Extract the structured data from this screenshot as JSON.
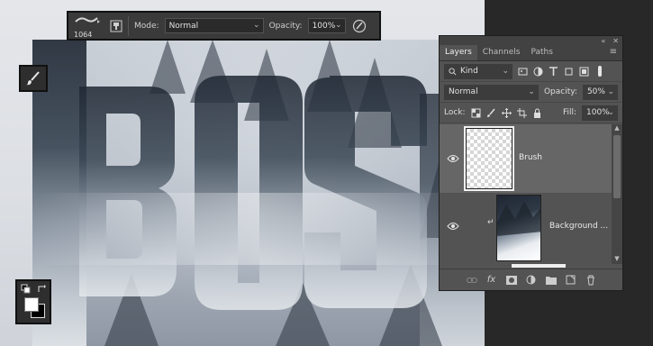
{
  "options_bar": {
    "brush_size": "1064",
    "mode_label": "Mode:",
    "mode_value": "Normal",
    "opacity_label": "Opacity:",
    "opacity_value": "100%"
  },
  "layers_panel": {
    "tabs": [
      "Layers",
      "Channels",
      "Paths"
    ],
    "active_tab": "Layers",
    "filter_kind": "Kind",
    "blend_mode": "Normal",
    "opacity_label": "Opacity:",
    "opacity_value": "50%",
    "lock_label": "Lock:",
    "fill_label": "Fill:",
    "fill_value": "100%",
    "layers": [
      {
        "name": "Brush",
        "selected": true,
        "visible": true,
        "type": "transparent"
      },
      {
        "name": "Background ...",
        "selected": false,
        "visible": true,
        "type": "photo",
        "clipped": true
      }
    ]
  },
  "canvas": {
    "artwork_text": "BOS"
  },
  "colors": {
    "panel_bg": "#535353",
    "selected_layer": "#666666",
    "foreground": "#ffffff",
    "background": "#000000"
  }
}
